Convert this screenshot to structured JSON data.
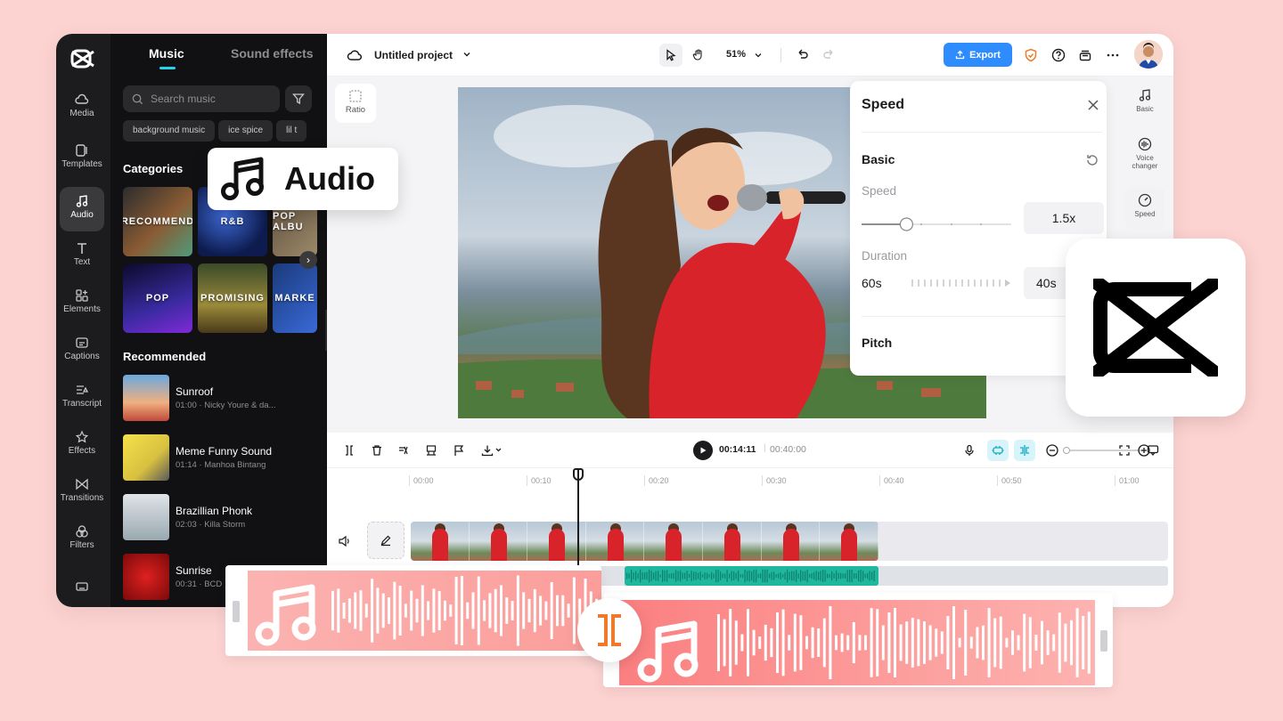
{
  "rail": {
    "items": [
      {
        "label": "Media",
        "icon": "cloud-icon"
      },
      {
        "label": "Templates",
        "icon": "templates-icon"
      },
      {
        "label": "Audio",
        "icon": "music-note-icon",
        "active": true
      },
      {
        "label": "Text",
        "icon": "text-icon"
      },
      {
        "label": "Elements",
        "icon": "elements-icon"
      },
      {
        "label": "Captions",
        "icon": "captions-icon"
      },
      {
        "label": "Transcript",
        "icon": "transcript-icon"
      },
      {
        "label": "Effects",
        "icon": "effects-icon"
      },
      {
        "label": "Transitions",
        "icon": "transitions-icon"
      },
      {
        "label": "Filters",
        "icon": "filters-icon"
      }
    ]
  },
  "music_panel": {
    "tabs": [
      "Music",
      "Sound effects"
    ],
    "search_placeholder": "Search music",
    "chips": [
      "background music",
      "ice spice",
      "lil t"
    ],
    "categories_title": "Categories",
    "categories": [
      "RECOMMEND",
      "R&B",
      "POP ALBU",
      "POP",
      "PROMISING",
      "MARKE"
    ],
    "recommended_title": "Recommended",
    "tracks": [
      {
        "name": "Sunroof",
        "meta": "01:00 · Nicky Youre & da..."
      },
      {
        "name": "Meme Funny Sound",
        "meta": "01:14 · Manhoa Bintang"
      },
      {
        "name": "Brazillian Phonk",
        "meta": "02:03 · Killa Storm"
      },
      {
        "name": "Sunrise",
        "meta": "00:31 · BCD"
      }
    ]
  },
  "topbar": {
    "project_title": "Untitled project",
    "zoom": "51%",
    "export_label": "Export"
  },
  "canvas": {
    "ratio_label": "Ratio"
  },
  "speed_panel": {
    "title": "Speed",
    "basic_label": "Basic",
    "speed_label": "Speed",
    "speed_value": "1.5x",
    "speed_fraction": 0.3,
    "duration_label": "Duration",
    "duration_original": "60s",
    "duration_new": "40s",
    "pitch_label": "Pitch"
  },
  "right_rail": {
    "items": [
      {
        "label": "Basic"
      },
      {
        "label": "Voice changer"
      },
      {
        "label": "Speed",
        "active": true
      }
    ]
  },
  "timeline": {
    "current_time": "00:14:11",
    "total_time": "00:40:00",
    "ruler": [
      "00:00",
      "00:10",
      "00:20",
      "00:30",
      "00:40",
      "00:50",
      "01:00"
    ]
  },
  "overlay": {
    "audio_card_label": "Audio"
  },
  "colors": {
    "background": "#fdd3d1",
    "accent": "#2f8cff",
    "teal": "#1fb79d",
    "wave_pink": "#fb8a8a",
    "split_orange": "#f07a2a"
  }
}
